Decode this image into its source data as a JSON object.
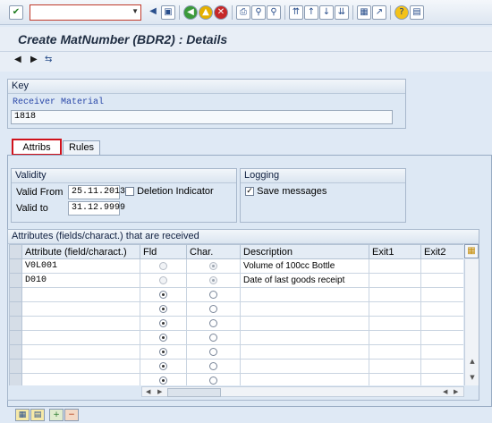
{
  "window": {
    "title": "Create MatNumber (BDR2) : Details"
  },
  "command_field": {
    "value": ""
  },
  "key": {
    "header": "Key",
    "receiver_label": "Receiver Material",
    "receiver_value": "1818"
  },
  "tabs": [
    {
      "label": "Attribs",
      "active": true
    },
    {
      "label": "Rules",
      "active": false
    }
  ],
  "validity": {
    "header": "Validity",
    "valid_from_label": "Valid From",
    "valid_from_value": "25.11.2013",
    "valid_to_label": "Valid to",
    "valid_to_value": "31.12.9999",
    "deletion_label": "Deletion Indicator",
    "deletion_checked": false
  },
  "logging": {
    "header": "Logging",
    "save_messages_label": "Save messages",
    "save_messages_checked": true
  },
  "attributes": {
    "header": "Attributes (fields/charact.) that are received",
    "columns": [
      "Attribute (field/charact.)",
      "Fld",
      "Char.",
      "Description",
      "Exit1",
      "Exit2"
    ],
    "rows": [
      {
        "attr": "V0L001",
        "fld": false,
        "chr": true,
        "desc": "Volume of 100cc Bottle",
        "disabled": true
      },
      {
        "attr": "D010",
        "fld": false,
        "chr": true,
        "desc": "Date of last goods receipt",
        "disabled": true
      },
      {
        "attr": "",
        "fld": true,
        "chr": false,
        "desc": "",
        "disabled": false
      },
      {
        "attr": "",
        "fld": true,
        "chr": false,
        "desc": "",
        "disabled": false
      },
      {
        "attr": "",
        "fld": true,
        "chr": false,
        "desc": "",
        "disabled": false
      },
      {
        "attr": "",
        "fld": true,
        "chr": false,
        "desc": "",
        "disabled": false
      },
      {
        "attr": "",
        "fld": true,
        "chr": false,
        "desc": "",
        "disabled": false
      },
      {
        "attr": "",
        "fld": true,
        "chr": false,
        "desc": "",
        "disabled": false
      },
      {
        "attr": "",
        "fld": true,
        "chr": false,
        "desc": "",
        "disabled": false
      }
    ]
  },
  "icons": {
    "toolbar": [
      "check-icon",
      "back-icon",
      "save-icon",
      "back-green-icon",
      "exit-icon",
      "cancel-icon",
      "print-icon",
      "find-icon",
      "find-next-icon",
      "first-page-icon",
      "prev-page-icon",
      "next-page-icon",
      "last-page-icon",
      "create-session-icon",
      "shortcut-icon",
      "help-icon",
      "customize-layout-icon"
    ],
    "app_toolbar": [
      "previous-arrow-icon",
      "next-arrow-icon",
      "hierarchy-icon"
    ],
    "bottom": [
      "select-all-icon",
      "deselect-all-icon",
      "insert-row-icon",
      "delete-row-icon"
    ]
  }
}
